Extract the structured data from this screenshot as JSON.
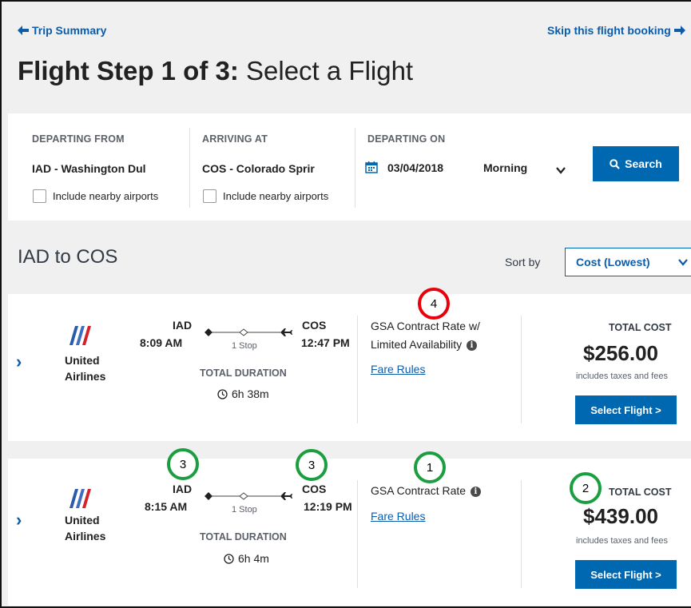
{
  "nav": {
    "back_label": "Trip Summary",
    "skip_label": "Skip this flight booking"
  },
  "page": {
    "title_step": "Flight Step 1 of 3:",
    "title_rest": "Select a Flight"
  },
  "search": {
    "departing_from_label": "DEPARTING FROM",
    "departing_from_value": "IAD - Washington Dul",
    "arriving_at_label": "ARRIVING AT",
    "arriving_at_value": "COS - Colorado Sprir",
    "nearby_label": "Include nearby airports",
    "departing_on_label": "DEPARTING ON",
    "date_value": "03/04/2018",
    "time_of_day": "Morning",
    "search_button": "Search"
  },
  "results": {
    "route_title": "IAD to COS",
    "sort_label": "Sort by",
    "sort_value": "Cost (Lowest)"
  },
  "flights": [
    {
      "airline_line1": "United",
      "airline_line2": "Airlines",
      "origin": "IAD",
      "depart_time": "8:09 AM",
      "destination": "COS",
      "arrive_time": "12:47 PM",
      "stops": "1 Stop",
      "duration_label": "TOTAL DURATION",
      "duration": "6h 38m",
      "fare_line1": "GSA Contract Rate w/",
      "fare_line2": "Limited Availability",
      "fare_rules": "Fare Rules",
      "total_label": "TOTAL COST",
      "price": "$256.00",
      "price_note": "includes taxes and fees",
      "select_label": "Select Flight >"
    },
    {
      "airline_line1": "United",
      "airline_line2": "Airlines",
      "origin": "IAD",
      "depart_time": "8:15 AM",
      "destination": "COS",
      "arrive_time": "12:19 PM",
      "stops": "1 Stop",
      "duration_label": "TOTAL DURATION",
      "duration": "6h 4m",
      "fare_line1": "GSA Contract Rate",
      "fare_rules": "Fare Rules",
      "total_label": "TOTAL COST",
      "price": "$439.00",
      "price_note": "includes taxes and fees",
      "select_label": "Select Flight >"
    }
  ],
  "annotations": {
    "m1": "1",
    "m2": "2",
    "m3a": "3",
    "m3b": "3",
    "m4": "4",
    "red_color": "#e8000b",
    "green_color": "#1a9e3f"
  },
  "colors": {
    "accent": "#0067b1",
    "link": "#0b5cab",
    "background": "#f0f0f0",
    "text": "#212121"
  }
}
